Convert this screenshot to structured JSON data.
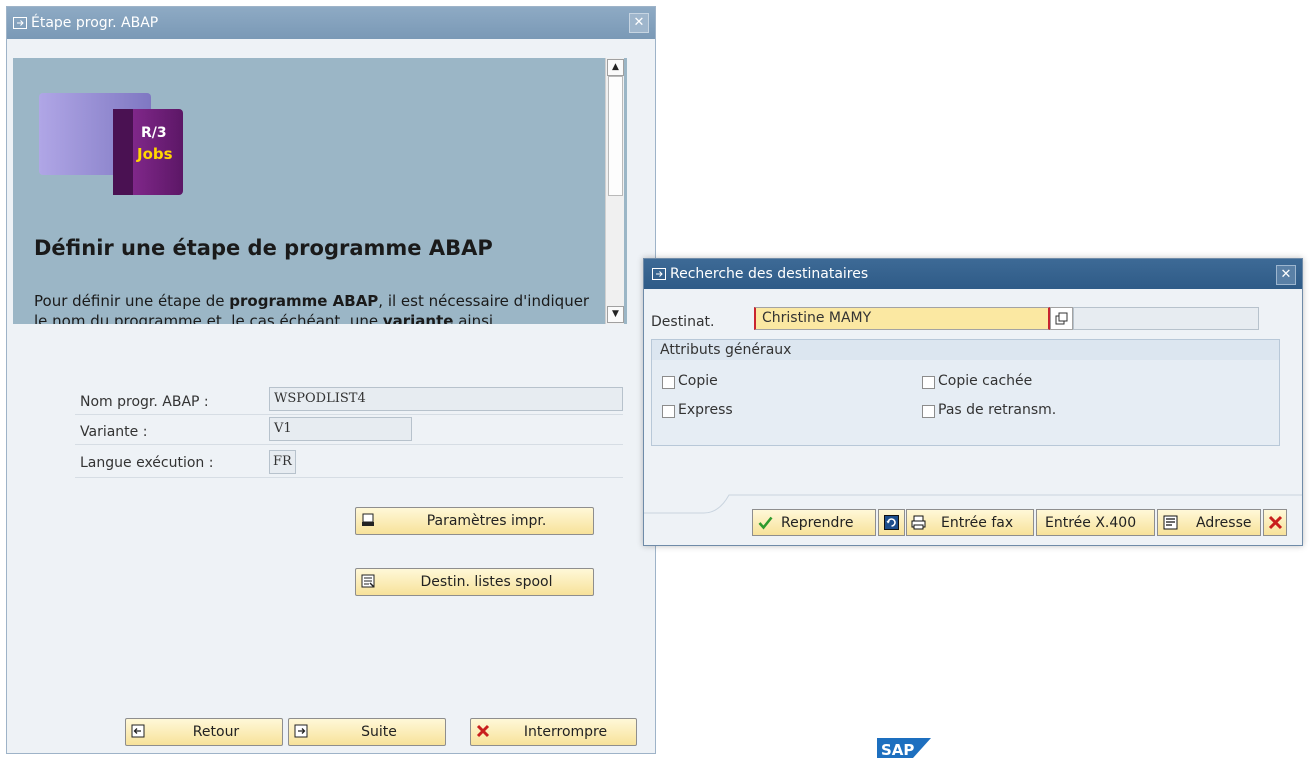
{
  "dialog1": {
    "title": "Étape progr. ABAP",
    "help": {
      "logo": {
        "line1": "R/3",
        "line2": "Jobs"
      },
      "title": "Définir une étape de programme ABAP",
      "text_pre": "Pour définir une étape de ",
      "text_bold1": "programme ABAP",
      "text_mid": ", il est nécessaire d'indiquer le nom du programme et, le cas échéant, une ",
      "text_bold2": "variante",
      "text_post": " ainsi"
    },
    "form": {
      "program_label": "Nom progr. ABAP :",
      "program_value": "WSPODLIST4",
      "variant_label": "Variante :",
      "variant_value": "V1",
      "language_label": "Langue exécution :",
      "language_value": "FR"
    },
    "buttons": {
      "print_params": "Paramètres impr.",
      "spool_recipients": "Destin. listes spool",
      "back": "Retour",
      "next": "Suite",
      "cancel": "Interrompre"
    }
  },
  "dialog2": {
    "title": "Recherche des destinataires",
    "recipient_label": "Destinat.",
    "recipient_value": "Christine MAMY",
    "group_title": "Attributs généraux",
    "checkboxes": {
      "copy": "Copie",
      "blind_copy": "Copie cachée",
      "express": "Express",
      "no_forward": "Pas de retransm."
    },
    "buttons": {
      "take_over": "Reprendre",
      "fax_entry": "Entrée fax",
      "x400_entry": "Entrée X.400",
      "address": "Adresse"
    }
  },
  "footer": {
    "logo_text": "SAP"
  },
  "colors": {
    "button_bg": "#f7e29a",
    "title_active": "#2f5b87",
    "title_inactive": "#8eaac4",
    "field_yellow": "#fbe8a2",
    "accept_green": "#2e9a2e",
    "cancel_red": "#c81e1e"
  }
}
